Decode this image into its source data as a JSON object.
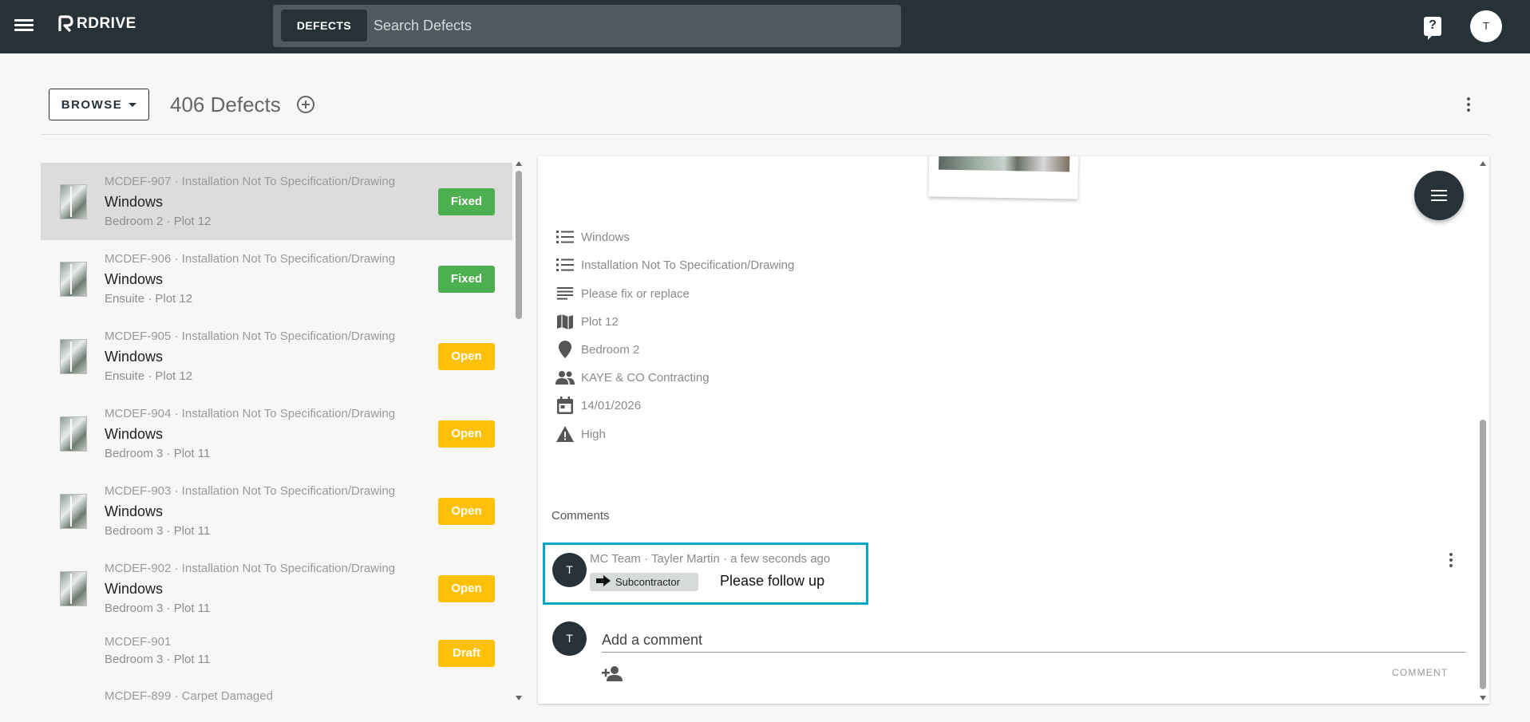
{
  "app": {
    "logo_text": "RDRIVE"
  },
  "search": {
    "chip_label": "DEFECTS",
    "placeholder": "Search Defects"
  },
  "user": {
    "initial": "T"
  },
  "header": {
    "browse_label": "BROWSE",
    "count_title": "406 Defects"
  },
  "defects": [
    {
      "ref": "MCDEF-907 · Installation Not To Specification/Drawing",
      "name": "Windows",
      "location": "Bedroom 2 · Plot 12",
      "status": "Fixed",
      "selected": true
    },
    {
      "ref": "MCDEF-906 · Installation Not To Specification/Drawing",
      "name": "Windows",
      "location": "Ensuite · Plot 12",
      "status": "Fixed"
    },
    {
      "ref": "MCDEF-905 · Installation Not To Specification/Drawing",
      "name": "Windows",
      "location": "Ensuite · Plot 12",
      "status": "Open"
    },
    {
      "ref": "MCDEF-904 · Installation Not To Specification/Drawing",
      "name": "Windows",
      "location": "Bedroom 3 · Plot 11",
      "status": "Open"
    },
    {
      "ref": "MCDEF-903 · Installation Not To Specification/Drawing",
      "name": "Windows",
      "location": "Bedroom 3 · Plot 11",
      "status": "Open"
    },
    {
      "ref": "MCDEF-902 · Installation Not To Specification/Drawing",
      "name": "Windows",
      "location": "Bedroom 3 · Plot 11",
      "status": "Open"
    },
    {
      "ref": "MCDEF-901",
      "name": "",
      "location": "Bedroom 3 · Plot 11",
      "status": "Draft"
    },
    {
      "ref": "MCDEF-899 · Carpet Damaged",
      "name": "",
      "location": "",
      "status": ""
    }
  ],
  "detail": {
    "properties": [
      {
        "icon": "list-icon",
        "text": "Windows"
      },
      {
        "icon": "list-icon",
        "text": "Installation Not To Specification/Drawing"
      },
      {
        "icon": "notes-icon",
        "text": "Please fix or replace"
      },
      {
        "icon": "map-icon",
        "text": "Plot 12"
      },
      {
        "icon": "location-pin-icon",
        "text": "Bedroom 2"
      },
      {
        "icon": "people-icon",
        "text": "KAYE & CO Contracting"
      },
      {
        "icon": "calendar-icon",
        "text": "14/01/2026"
      },
      {
        "icon": "warning-icon",
        "text": "High"
      }
    ],
    "comments_label": "Comments",
    "comment": {
      "avatar": "T",
      "meta": "MC Team · Tayler Martin · a few seconds ago",
      "chip": "Subcontractor",
      "text": "Please follow up"
    },
    "new_comment": {
      "avatar": "T",
      "placeholder": "Add a comment",
      "submit_label": "COMMENT"
    }
  },
  "colors": {
    "topbar": "#263238",
    "fixed": "#4caf50",
    "open": "#ffc107",
    "highlight": "#00a6c7"
  }
}
